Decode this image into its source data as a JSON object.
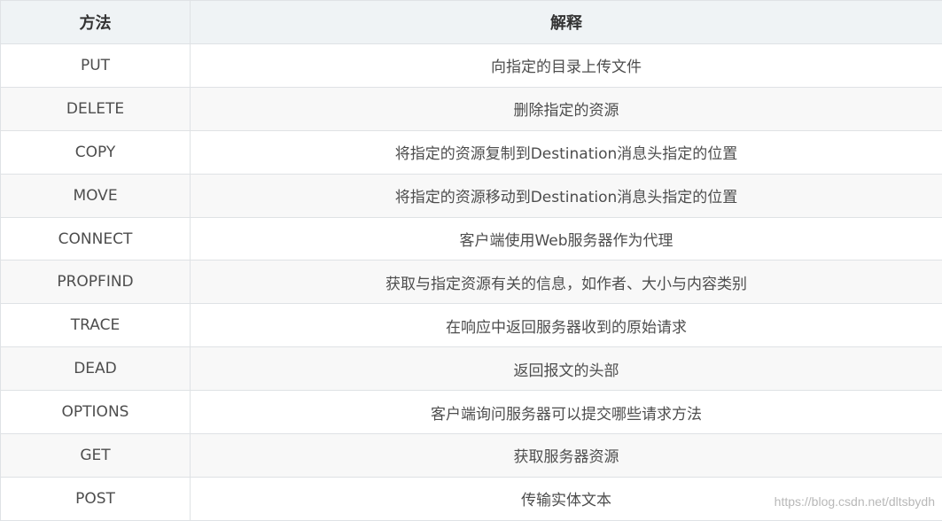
{
  "header": {
    "col_method": "方法",
    "col_description": "解释"
  },
  "rows": [
    {
      "method": "PUT",
      "description": "向指定的目录上传文件"
    },
    {
      "method": "DELETE",
      "description": "删除指定的资源"
    },
    {
      "method": "COPY",
      "description": "将指定的资源复制到Destination消息头指定的位置"
    },
    {
      "method": "MOVE",
      "description": "将指定的资源移动到Destination消息头指定的位置"
    },
    {
      "method": "CONNECT",
      "description": "客户端使用Web服务器作为代理"
    },
    {
      "method": "PROPFIND",
      "description": "获取与指定资源有关的信息，如作者、大小与内容类别"
    },
    {
      "method": "TRACE",
      "description": "在响应中返回服务器收到的原始请求"
    },
    {
      "method": "DEAD",
      "description": "返回报文的头部"
    },
    {
      "method": "OPTIONS",
      "description": "客户端询问服务器可以提交哪些请求方法"
    },
    {
      "method": "GET",
      "description": "获取服务器资源"
    },
    {
      "method": "POST",
      "description": "传输实体文本"
    }
  ],
  "watermark": "https://blog.csdn.net/dltsbydh"
}
